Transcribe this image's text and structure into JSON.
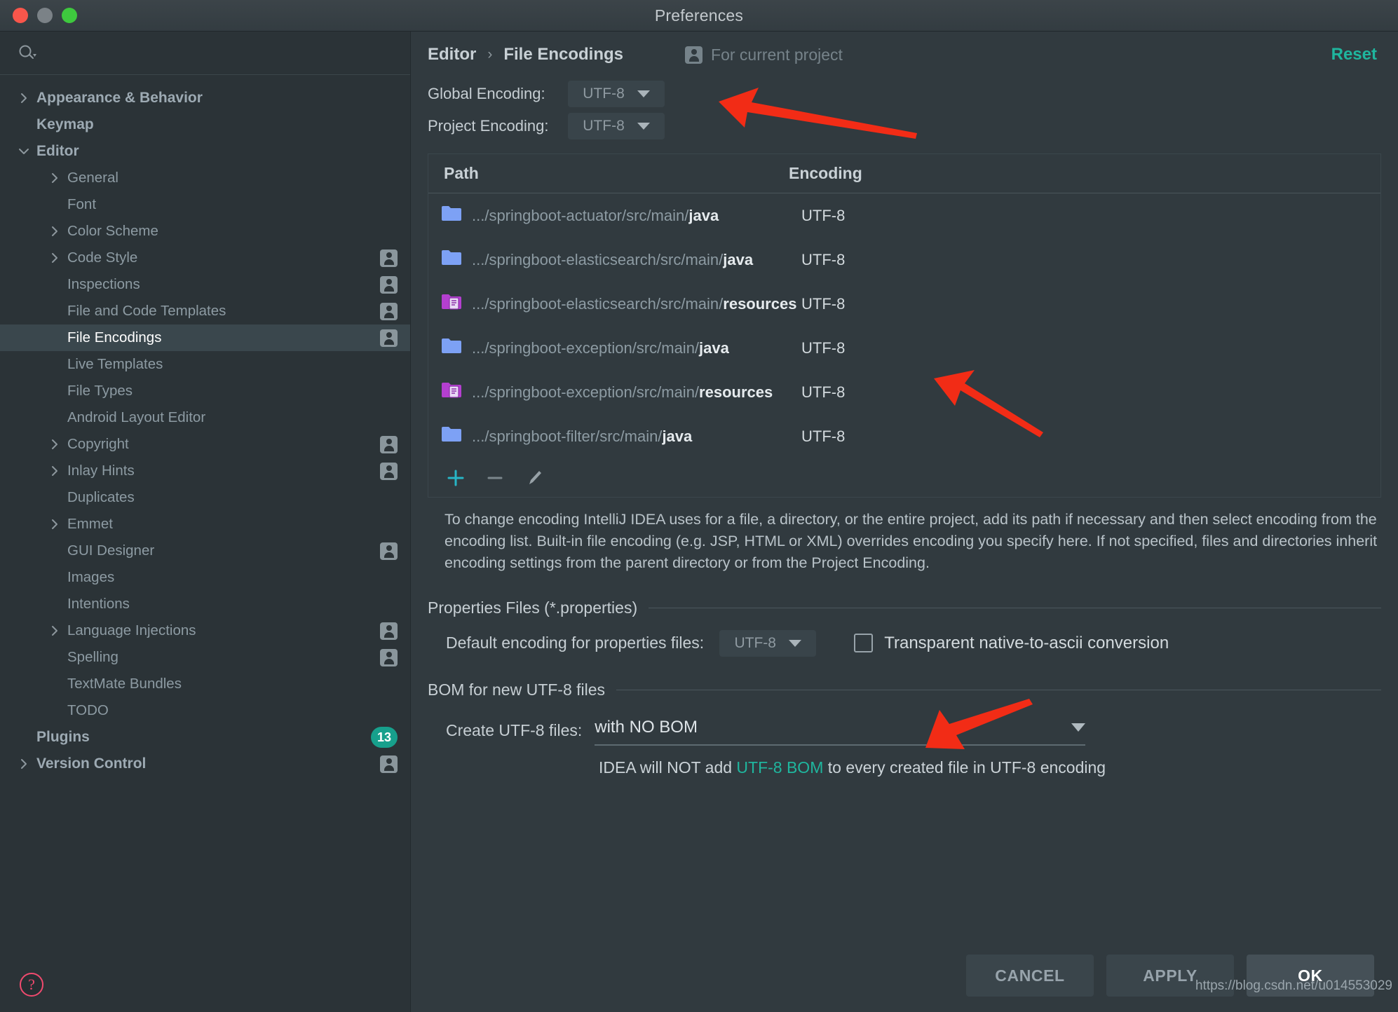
{
  "window": {
    "title": "Preferences",
    "traffic_lights": [
      "close-button",
      "minimize-button",
      "maximize-button"
    ]
  },
  "sidebar": {
    "search": {
      "placeholder": "",
      "value": "",
      "icon": "search-icon"
    },
    "items": [
      {
        "label": "Appearance & Behavior",
        "chevron": "right",
        "indent": 0,
        "bold": true,
        "badge": "",
        "selected": false
      },
      {
        "label": "Keymap",
        "chevron": "none",
        "indent": 0,
        "bold": true,
        "badge": "",
        "selected": false
      },
      {
        "label": "Editor",
        "chevron": "down",
        "indent": 0,
        "bold": true,
        "badge": "",
        "selected": false
      },
      {
        "label": "General",
        "chevron": "right",
        "indent": 1,
        "bold": false,
        "badge": "",
        "selected": false
      },
      {
        "label": "Font",
        "chevron": "none",
        "indent": 1,
        "bold": false,
        "badge": "",
        "selected": false
      },
      {
        "label": "Color Scheme",
        "chevron": "right",
        "indent": 1,
        "bold": false,
        "badge": "",
        "selected": false
      },
      {
        "label": "Code Style",
        "chevron": "right",
        "indent": 1,
        "bold": false,
        "badge": "user",
        "selected": false
      },
      {
        "label": "Inspections",
        "chevron": "none",
        "indent": 1,
        "bold": false,
        "badge": "user",
        "selected": false
      },
      {
        "label": "File and Code Templates",
        "chevron": "none",
        "indent": 1,
        "bold": false,
        "badge": "user",
        "selected": false
      },
      {
        "label": "File Encodings",
        "chevron": "none",
        "indent": 1,
        "bold": false,
        "badge": "user",
        "selected": true
      },
      {
        "label": "Live Templates",
        "chevron": "none",
        "indent": 1,
        "bold": false,
        "badge": "",
        "selected": false
      },
      {
        "label": "File Types",
        "chevron": "none",
        "indent": 1,
        "bold": false,
        "badge": "",
        "selected": false
      },
      {
        "label": "Android Layout Editor",
        "chevron": "none",
        "indent": 1,
        "bold": false,
        "badge": "",
        "selected": false
      },
      {
        "label": "Copyright",
        "chevron": "right",
        "indent": 1,
        "bold": false,
        "badge": "user",
        "selected": false
      },
      {
        "label": "Inlay Hints",
        "chevron": "right",
        "indent": 1,
        "bold": false,
        "badge": "user",
        "selected": false
      },
      {
        "label": "Duplicates",
        "chevron": "none",
        "indent": 1,
        "bold": false,
        "badge": "",
        "selected": false
      },
      {
        "label": "Emmet",
        "chevron": "right",
        "indent": 1,
        "bold": false,
        "badge": "",
        "selected": false
      },
      {
        "label": "GUI Designer",
        "chevron": "none",
        "indent": 1,
        "bold": false,
        "badge": "user",
        "selected": false
      },
      {
        "label": "Images",
        "chevron": "none",
        "indent": 1,
        "bold": false,
        "badge": "",
        "selected": false
      },
      {
        "label": "Intentions",
        "chevron": "none",
        "indent": 1,
        "bold": false,
        "badge": "",
        "selected": false
      },
      {
        "label": "Language Injections",
        "chevron": "right",
        "indent": 1,
        "bold": false,
        "badge": "user",
        "selected": false
      },
      {
        "label": "Spelling",
        "chevron": "none",
        "indent": 1,
        "bold": false,
        "badge": "user",
        "selected": false
      },
      {
        "label": "TextMate Bundles",
        "chevron": "none",
        "indent": 1,
        "bold": false,
        "badge": "",
        "selected": false
      },
      {
        "label": "TODO",
        "chevron": "none",
        "indent": 1,
        "bold": false,
        "badge": "",
        "selected": false
      },
      {
        "label": "Plugins",
        "chevron": "none",
        "indent": 0,
        "bold": true,
        "badge": "13",
        "selected": false
      },
      {
        "label": "Version Control",
        "chevron": "right",
        "indent": 0,
        "bold": true,
        "badge": "user",
        "selected": false
      }
    ],
    "help_button": {
      "label": "?",
      "name": "help-icon"
    }
  },
  "main": {
    "breadcrumb": {
      "parent": "Editor",
      "separator": "›",
      "current": "File Encodings"
    },
    "scope_label": "For current project",
    "reset_label": "Reset",
    "global_encoding": {
      "label": "Global Encoding:",
      "value": "UTF-8"
    },
    "project_encoding": {
      "label": "Project Encoding:",
      "value": "UTF-8"
    },
    "table": {
      "columns": [
        "Path",
        "Encoding"
      ],
      "rows": [
        {
          "icon": "folder-icon",
          "prefix": ".../springboot-actuator/src/main/",
          "leaf": "java",
          "encoding": "UTF-8"
        },
        {
          "icon": "folder-icon",
          "prefix": ".../springboot-elasticsearch/src/main/",
          "leaf": "java",
          "encoding": "UTF-8"
        },
        {
          "icon": "resources-icon",
          "prefix": ".../springboot-elasticsearch/src/main/",
          "leaf": "resources",
          "encoding": "UTF-8"
        },
        {
          "icon": "folder-icon",
          "prefix": ".../springboot-exception/src/main/",
          "leaf": "java",
          "encoding": "UTF-8"
        },
        {
          "icon": "resources-icon",
          "prefix": ".../springboot-exception/src/main/",
          "leaf": "resources",
          "encoding": "UTF-8"
        },
        {
          "icon": "folder-icon",
          "prefix": ".../springboot-filter/src/main/",
          "leaf": "java",
          "encoding": "UTF-8"
        }
      ]
    },
    "table_toolbar": [
      {
        "name": "add-button",
        "glyph": "+"
      },
      {
        "name": "remove-button",
        "glyph": "−"
      },
      {
        "name": "edit-button",
        "glyph": "✎"
      }
    ],
    "description": "To change encoding IntelliJ IDEA uses for a file, a directory, or the entire project, add its path if necessary and then select encoding from the encoding list. Built-in file encoding (e.g. JSP, HTML or XML) overrides encoding you specify here. If not specified, files and directories inherit encoding settings from the parent directory or from the Project Encoding.",
    "properties_section": {
      "title": "Properties Files (*.properties)",
      "default_encoding_label": "Default encoding for properties files:",
      "default_encoding_value": "UTF-8",
      "transparent_checkbox_label": "Transparent native-to-ascii conversion",
      "transparent_checkbox_checked": false
    },
    "bom_section": {
      "title": "BOM for new UTF-8 files",
      "create_label": "Create UTF-8 files:",
      "create_value": "with NO BOM",
      "note_prefix": "IDEA will NOT add ",
      "note_highlight": "UTF-8 BOM",
      "note_suffix": " to every created file in UTF-8 encoding"
    }
  },
  "footer": {
    "cancel_label": "CANCEL",
    "apply_label": "APPLY",
    "ok_label": "OK"
  },
  "watermark": "https://blog.csdn.net/u014553029",
  "colors": {
    "accent_teal": "#1fb69e",
    "window_bg": "#313a3f",
    "sidebar_bg": "#2b3337",
    "selection_bg": "#3a474d",
    "annotation_red": "#f22c16",
    "badge_green": "#17a08c"
  }
}
